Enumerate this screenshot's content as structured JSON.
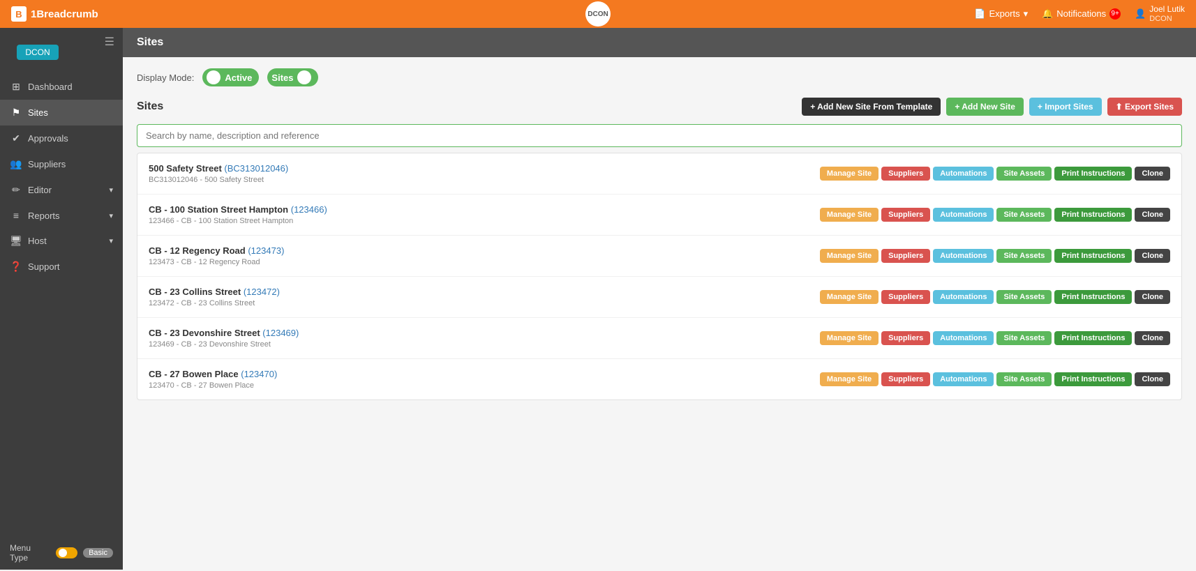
{
  "navbar": {
    "brand_icon": "B",
    "brand_name": "1Breadcrumb",
    "logo_text": "DCON",
    "exports_label": "Exports",
    "notifications_label": "Notifications",
    "notification_count": "9+",
    "user_name": "Joel Lutik",
    "user_org": "DCON"
  },
  "sidebar": {
    "tenant_label": "DCON",
    "items": [
      {
        "id": "dashboard",
        "label": "Dashboard",
        "icon": "⊞",
        "has_chevron": false
      },
      {
        "id": "sites",
        "label": "Sites",
        "icon": "⚑",
        "has_chevron": false,
        "active": true
      },
      {
        "id": "approvals",
        "label": "Approvals",
        "icon": "✔",
        "has_chevron": false
      },
      {
        "id": "suppliers",
        "label": "Suppliers",
        "icon": "👥",
        "has_chevron": false
      },
      {
        "id": "editor",
        "label": "Editor",
        "icon": "✏",
        "has_chevron": true
      },
      {
        "id": "reports",
        "label": "Reports",
        "icon": "≡",
        "has_chevron": true
      },
      {
        "id": "host",
        "label": "Host",
        "icon": "?",
        "has_chevron": true
      },
      {
        "id": "support",
        "label": "Support",
        "icon": "?",
        "has_chevron": false
      }
    ],
    "menu_type_label": "Menu Type",
    "menu_basic_label": "Basic"
  },
  "page": {
    "header": "Sites",
    "display_mode_label": "Display Mode:",
    "active_toggle_label": "Active",
    "sites_toggle_label": "Sites",
    "section_title": "Sites"
  },
  "toolbar": {
    "add_from_template": "+ Add New Site From Template",
    "add_new": "+ Add New Site",
    "import": "+ Import Sites",
    "export": "⬆ Export Sites"
  },
  "search": {
    "placeholder": "Search by name, description and reference"
  },
  "sites": [
    {
      "name": "500 Safety Street",
      "ref_code": "BC313012046",
      "ref_line": "BC313012046 - 500 Safety Street"
    },
    {
      "name": "CB - 100 Station Street Hampton",
      "ref_code": "123466",
      "ref_line": "123466 - CB - 100 Station Street Hampton"
    },
    {
      "name": "CB - 12 Regency Road",
      "ref_code": "123473",
      "ref_line": "123473 - CB - 12 Regency Road"
    },
    {
      "name": "CB - 23 Collins Street",
      "ref_code": "123472",
      "ref_line": "123472 - CB - 23 Collins Street"
    },
    {
      "name": "CB - 23 Devonshire Street",
      "ref_code": "123469",
      "ref_line": "123469 - CB - 23 Devonshire Street"
    },
    {
      "name": "CB - 27 Bowen Place",
      "ref_code": "123470",
      "ref_line": "123470 - CB - 27 Bowen Place"
    }
  ],
  "action_buttons": {
    "manage_site": "Manage Site",
    "suppliers": "Suppliers",
    "automations": "Automations",
    "site_assets": "Site Assets",
    "print_instructions": "Print Instructions",
    "clone": "Clone"
  }
}
